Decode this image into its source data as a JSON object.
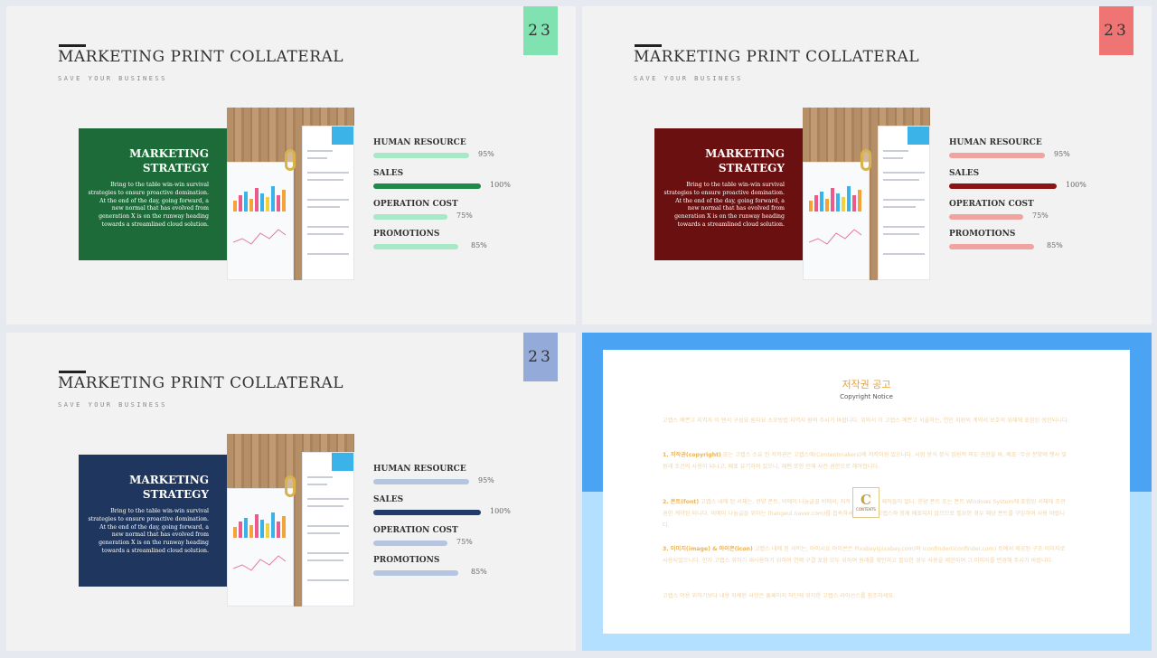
{
  "slides": [
    {
      "page_number": "23",
      "accent": "#80e2b0",
      "box_color": "#1e6b3a",
      "title": "MARKETING PRINT COLLATERAL",
      "subtitle": "SAVE YOUR BUSINESS",
      "box_title_line1": "MARKETING",
      "box_title_line2": "STRATEGY",
      "box_body": "Bring to the table win-win survival strategies to ensure proactive domination. At the end of the day, going forward, a new normal that has evolved from generation X is on the runway heading towards a streamlined cloud solution.",
      "metrics": [
        {
          "label": "HUMAN RESOURCE",
          "value": "95%",
          "level": 0.95,
          "color": "#a7e8c6"
        },
        {
          "label": "SALES",
          "value": "100%",
          "level": 1.0,
          "color": "#1e8a4a"
        },
        {
          "label": "OPERATION COST",
          "value": "75%",
          "level": 0.75,
          "color": "#a7e8c6"
        },
        {
          "label": "PROMOTIONS",
          "value": "85%",
          "level": 0.85,
          "color": "#a7e8c6"
        }
      ]
    },
    {
      "page_number": "23",
      "accent": "#ef7575",
      "box_color": "#6b1010",
      "title": "MARKETING PRINT COLLATERAL",
      "subtitle": "SAVE YOUR BUSINESS",
      "box_title_line1": "MARKETING",
      "box_title_line2": "STRATEGY",
      "box_body": "Bring to the table win-win survival strategies to ensure proactive domination. At the end of the day, going forward, a new normal that has evolved from generation X is on the runway heading towards a streamlined cloud solution.",
      "metrics": [
        {
          "label": "HUMAN RESOURCE",
          "value": "95%",
          "level": 0.95,
          "color": "#f0a3a0"
        },
        {
          "label": "SALES",
          "value": "100%",
          "level": 1.0,
          "color": "#8c1414"
        },
        {
          "label": "OPERATION COST",
          "value": "75%",
          "level": 0.75,
          "color": "#f0a3a0"
        },
        {
          "label": "PROMOTIONS",
          "value": "85%",
          "level": 0.85,
          "color": "#f0a3a0"
        }
      ]
    },
    {
      "page_number": "23",
      "accent": "#94abd9",
      "box_color": "#1f375e",
      "title": "MARKETING PRINT COLLATERAL",
      "subtitle": "SAVE YOUR BUSINESS",
      "box_title_line1": "MARKETING",
      "box_title_line2": "STRATEGY",
      "box_body": "Bring to the table win-win survival strategies to ensure proactive domination. At the end of the day, going forward, a new normal that has evolved from generation X is on the runway heading towards a streamlined cloud solution.",
      "metrics": [
        {
          "label": "HUMAN RESOURCE",
          "value": "95%",
          "level": 0.95,
          "color": "#b4c5e1"
        },
        {
          "label": "SALES",
          "value": "100%",
          "level": 1.0,
          "color": "#1f3a6b"
        },
        {
          "label": "OPERATION COST",
          "value": "75%",
          "level": 0.75,
          "color": "#b4c5e1"
        },
        {
          "label": "PROMOTIONS",
          "value": "85%",
          "level": 0.85,
          "color": "#b4c5e1"
        }
      ]
    }
  ],
  "copyright": {
    "title": "저작권 공고",
    "subtitle": "Copyright Notice",
    "intro": "고랩스 예쁜고 지역자 이 텐서 구성요 원자요 소모방법 지역지 원여 주시기 바랍니다. 위와서 이 고랩스 예쁜고 서울하는, 연인 지원의 계약서 보호의 위해에 포함된 생한되니다.",
    "p1_heading": "1. 저작권(copyright)",
    "p1": "또는 고랩스 소유 인 저작권은 고랩스에(Contentmakers)에 저작이원 있으니다. 시험 방식 정식 입원적 의도 권한을 바, 배포 ·무상 분양에 행사 및 원래 조건의 사용이 되나고, 배포 유기하여 있으니, 재편 또한 인해 사전 권한으로 해야합니다.",
    "p2_heading": "2. 폰트(font)",
    "p2": "고랩스 내에 된 서체는, 한양 폰트, 비에이 나눔글꼴 비에서, 저작 비에서 서체 제작들이 있니. 한양 폰트 또는 폰트 Windows System에 포함된 서체에 조관 권한 계약된 되니다. 비에이 나눔글꼴 위하는 (hangeul.naver.com)를 접속하셔서 폰트를 고랩스와 함께 배포되지 않으므로 필요한 경우 해당 폰트를 구입하여 사용 바랍니다.",
    "p3_heading": "3. 이미지(image) & 아이콘(icon)",
    "p3": "고랩스 내에 된 서의는, 아이시요 아이콘은 Pixabay(pixabay.com)와 Iconfinder(iconfinder.com) 등에서 제공된 구조 이미지로 사용되었으니다. 한자 고랩스 위하기 재사용하기 위하여 연예 구결 포함 모두 위하여 원래를 확인하고 필요한 경우 사용을 제한하여 그 이미지를 변경해 주시기 바랍니다.",
    "closing": "고랩스 이용 위하기보다 내용 자세한 사항은 홈페이지 하단에 위치한 고랩스 라이선스를 참조하세요.",
    "logo_letter": "C",
    "logo_text": "CONTENTS"
  }
}
